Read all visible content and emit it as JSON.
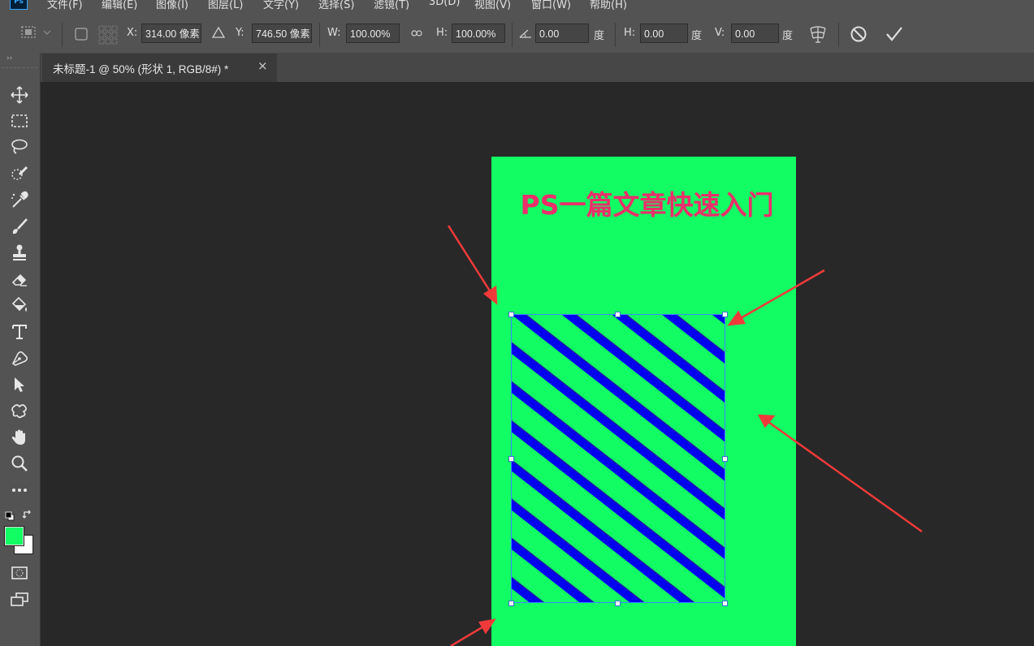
{
  "app": {
    "logo_text": "Ps"
  },
  "menu": [
    "文件(F)",
    "编辑(E)",
    "图像(I)",
    "图层(L)",
    "文字(Y)",
    "选择(S)",
    "滤镜(T)",
    "3D(D)",
    "视图(V)",
    "窗口(W)",
    "帮助(H)"
  ],
  "options": {
    "x_label": "X:",
    "x_value": "314.00 像素",
    "y_label": "Y:",
    "y_value": "746.50 像素",
    "w_label": "W:",
    "w_value": "100.00%",
    "h_label": "H:",
    "h_value": "100.00%",
    "rotate_value": "0.00",
    "rotate_unit": "度",
    "skew_h_label": "H:",
    "skew_h_value": "0.00",
    "skew_h_unit": "度",
    "skew_v_label": "V:",
    "skew_v_value": "0.00",
    "skew_v_unit": "度"
  },
  "tab": {
    "title": "未标题-1 @ 50% (形状 1, RGB/8#) *",
    "close": "×"
  },
  "canvas": {
    "title": "PS一篇文章快速入门",
    "background_color": "#12fc64",
    "title_color": "#ea2f6a",
    "stripe_color": "#0000ee"
  },
  "colors": {
    "foreground": "#12fc64",
    "background": "#ffffff",
    "annotation_arrow": "#f03a3a"
  },
  "tools": [
    "move-tool",
    "marquee-tool",
    "lasso-tool",
    "quick-select-tool",
    "eyedropper-tool",
    "brush-tool",
    "stamp-tool",
    "eraser-tool",
    "paint-bucket-tool",
    "type-tool",
    "pen-tool",
    "path-select-tool",
    "custom-shape-tool",
    "hand-tool",
    "zoom-tool",
    "more-tools",
    "quick-mask-tool",
    "screen-mode-tool"
  ]
}
